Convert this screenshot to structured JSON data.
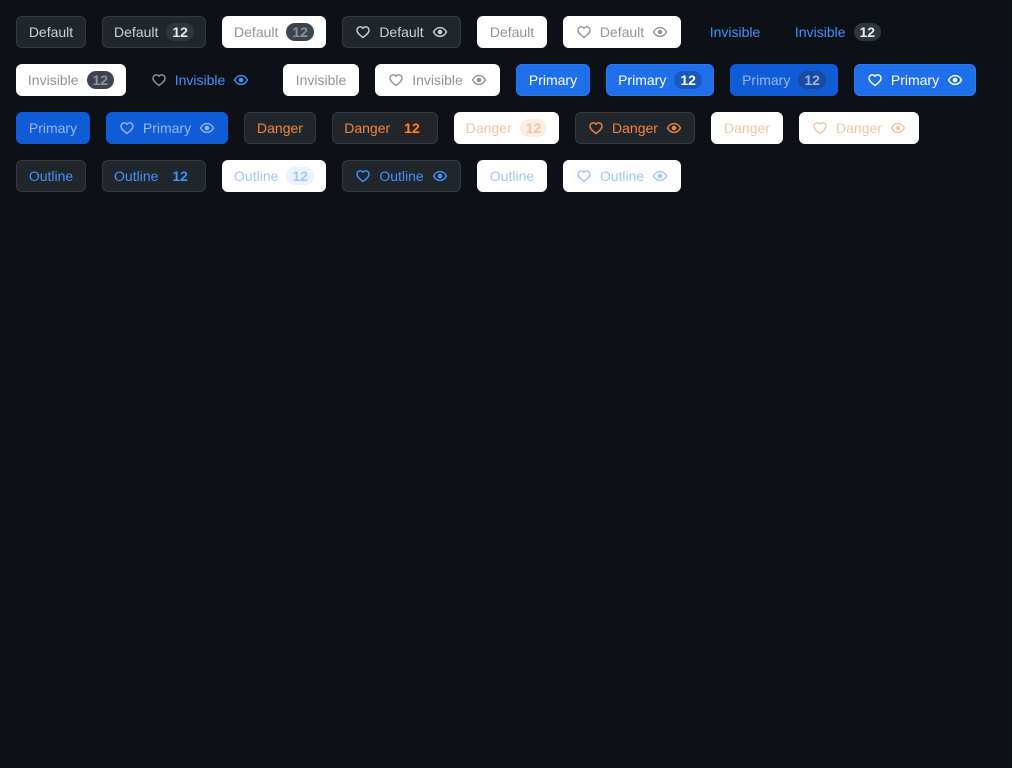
{
  "colors": {
    "background": "#0d1117",
    "accent": "#4493f8",
    "primary": "#1f6feb",
    "danger": "#f0883e"
  },
  "icons": {
    "leading": "heart-icon",
    "trailing": "eye-icon"
  },
  "rows": [
    [
      {
        "label": "Default",
        "variant": "default",
        "disabled": false
      },
      {
        "label": "Default",
        "variant": "default",
        "disabled": false,
        "count": "12"
      },
      {
        "label": "Default",
        "variant": "default",
        "disabled": true,
        "count": "12"
      },
      {
        "label": "Default",
        "variant": "default",
        "disabled": false,
        "icons": true
      },
      {
        "label": "Default",
        "variant": "default",
        "disabled": true
      },
      {
        "label": "Default",
        "variant": "default",
        "disabled": true,
        "icons": true
      },
      {
        "label": "Invisible",
        "variant": "invisible",
        "disabled": false
      },
      {
        "label": "Invisible",
        "variant": "invisible",
        "disabled": false,
        "count": "12"
      }
    ],
    [
      {
        "label": "Invisible",
        "variant": "invisible",
        "disabled": true,
        "count": "12"
      },
      {
        "label": "Invisible",
        "variant": "invisible",
        "disabled": false,
        "icons": true
      },
      {
        "label": "Invisible",
        "variant": "invisible",
        "disabled": true
      },
      {
        "label": "Invisible",
        "variant": "invisible",
        "disabled": true,
        "icons": true
      },
      {
        "label": "Primary",
        "variant": "primary",
        "disabled": false
      },
      {
        "label": "Primary",
        "variant": "primary",
        "disabled": false,
        "count": "12"
      },
      {
        "label": "Primary",
        "variant": "primary",
        "disabled": true,
        "count": "12"
      },
      {
        "label": "Primary",
        "variant": "primary",
        "disabled": false,
        "icons": true
      }
    ],
    [
      {
        "label": "Primary",
        "variant": "primary",
        "disabled": true
      },
      {
        "label": "Primary",
        "variant": "primary",
        "disabled": true,
        "icons": true
      },
      {
        "label": "Danger",
        "variant": "danger",
        "disabled": false
      },
      {
        "label": "Danger",
        "variant": "danger",
        "disabled": false,
        "count": "12"
      },
      {
        "label": "Danger",
        "variant": "danger",
        "disabled": true,
        "count": "12"
      },
      {
        "label": "Danger",
        "variant": "danger",
        "disabled": false,
        "icons": true
      },
      {
        "label": "Danger",
        "variant": "danger",
        "disabled": true
      },
      {
        "label": "Danger",
        "variant": "danger",
        "disabled": true,
        "icons": true
      }
    ],
    [
      {
        "label": "Outline",
        "variant": "outline",
        "disabled": false
      },
      {
        "label": "Outline",
        "variant": "outline",
        "disabled": false,
        "count": "12"
      },
      {
        "label": "Outline",
        "variant": "outline",
        "disabled": true,
        "count": "12"
      },
      {
        "label": "Outline",
        "variant": "outline",
        "disabled": false,
        "icons": true
      },
      {
        "label": "Outline",
        "variant": "outline",
        "disabled": true
      },
      {
        "label": "Outline",
        "variant": "outline",
        "disabled": true,
        "icons": true
      }
    ]
  ]
}
